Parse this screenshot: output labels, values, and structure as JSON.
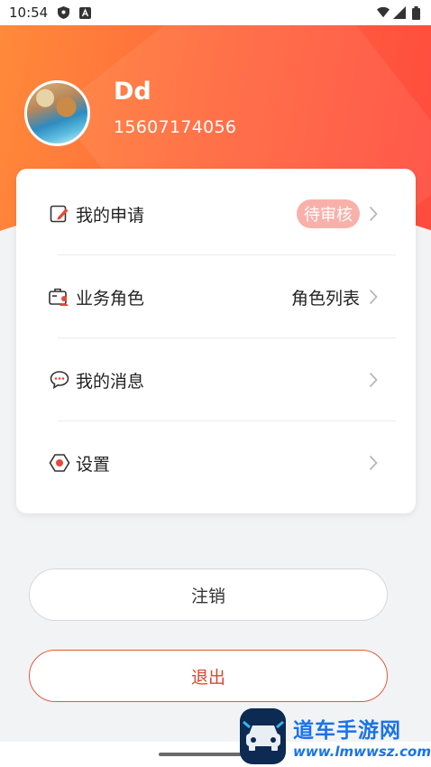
{
  "status_bar": {
    "time": "10:54"
  },
  "profile": {
    "name": "Dd",
    "phone": "15607174056"
  },
  "menu": {
    "items": [
      {
        "label": "我的申请",
        "badge": "待审核",
        "icon": "edit-note-icon"
      },
      {
        "label": "业务角色",
        "value": "角色列表",
        "icon": "briefcase-user-icon"
      },
      {
        "label": "我的消息",
        "icon": "chat-bubble-icon"
      },
      {
        "label": "设置",
        "icon": "settings-hex-icon"
      }
    ]
  },
  "buttons": {
    "cancel_label": "注销",
    "logout_label": "退出"
  },
  "watermark": {
    "cn": "道车手游网",
    "url": "www.lmwwsz.com"
  },
  "colors": {
    "accent": "#ff5a3c",
    "badge_bg": "#f8b1aa",
    "logout_text": "#e0452a"
  }
}
